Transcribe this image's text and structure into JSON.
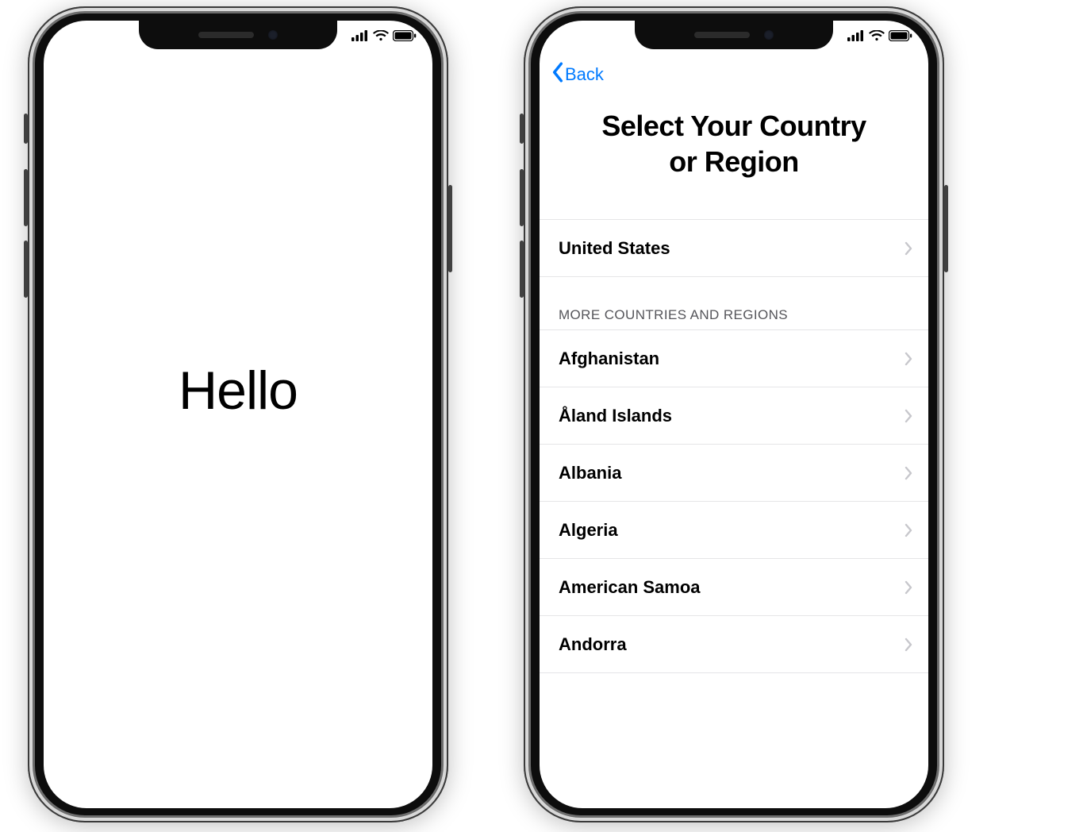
{
  "left_phone": {
    "greeting": "Hello"
  },
  "right_phone": {
    "nav_back_label": "Back",
    "title_line1": "Select Your Country",
    "title_line2": "or Region",
    "featured_region": "United States",
    "more_header": "MORE COUNTRIES AND REGIONS",
    "regions": [
      "Afghanistan",
      "Åland Islands",
      "Albania",
      "Algeria",
      "American Samoa",
      "Andorra"
    ]
  },
  "icons": {
    "signal": "cellular-signal-icon",
    "wifi": "wifi-icon",
    "battery": "battery-icon",
    "chevron_left": "chevron-left-icon",
    "chevron_right": "chevron-right-icon"
  },
  "colors": {
    "ios_blue": "#007aff",
    "separator": "#e5e5e7",
    "chevron_gray": "#c7c7cc"
  }
}
